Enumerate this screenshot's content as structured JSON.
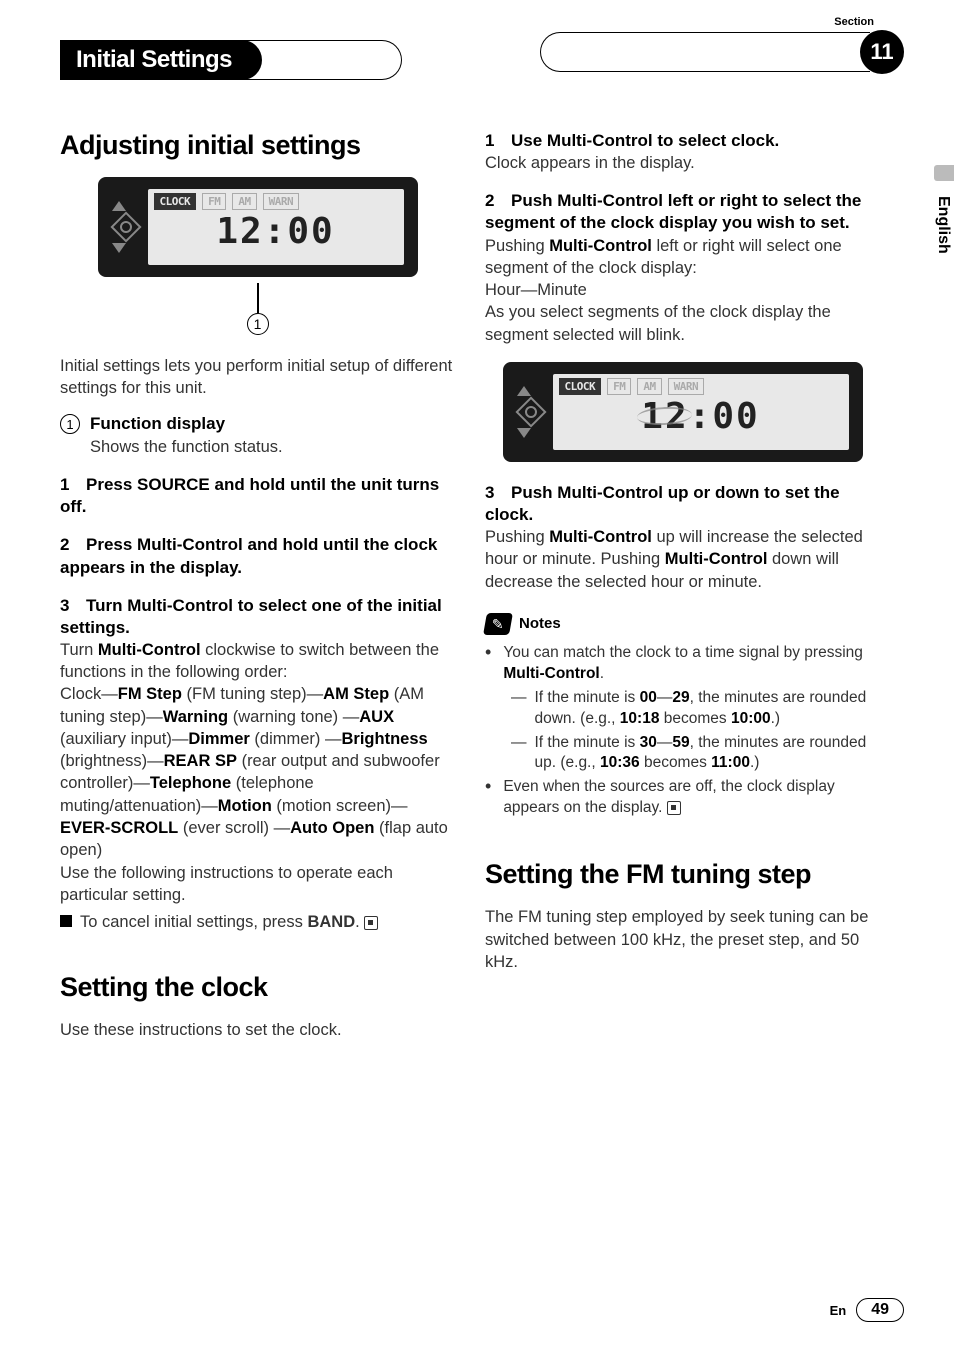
{
  "header": {
    "section_title": "Initial Settings",
    "section_label": "Section",
    "section_number": "11"
  },
  "sidebar": {
    "language": "English"
  },
  "left": {
    "h1": "Adjusting initial settings",
    "lcd": {
      "tags": [
        "CLOCK",
        "FM",
        "AM",
        "WARN"
      ],
      "time": "12:00",
      "callout": "1"
    },
    "intro": "Initial settings lets you perform initial setup of different settings for this unit.",
    "def_num": "1",
    "def_title": "Function display",
    "def_desc": "Shows the function status.",
    "step1_num": "1",
    "step1_title": "Press SOURCE and hold until the unit turns off.",
    "step2_num": "2",
    "step2_title": "Press Multi-Control and hold until the clock appears in the display.",
    "step3_num": "3",
    "step3_title": "Turn Multi-Control to select one of the initial settings.",
    "step3_body_a": "Turn ",
    "step3_body_mc": "Multi-Control",
    "step3_body_b": " clockwise to switch between the functions in the following order:",
    "step3_seq_parts": {
      "p1": "Clock—",
      "b1": "FM Step",
      "p2": " (FM tuning step)—",
      "b2": "AM Step",
      "p3": " (AM tuning step)—",
      "b3": "Warning",
      "p4": " (warning tone) —",
      "b4": "AUX",
      "p5": " (auxiliary input)—",
      "b5": "Dimmer",
      "p6": " (dimmer) —",
      "b6": "Brightness",
      "p7": " (brightness)—",
      "b7": "REAR SP",
      "p8": " (rear output and subwoofer controller)—",
      "b8": "Telephone",
      "p9": " (telephone muting/attenuation)—",
      "b9": "Motion",
      "p10": " (motion screen)—",
      "b10": "EVER-SCROLL",
      "p11": " (ever scroll) —",
      "b11": "Auto Open",
      "p12": " (flap auto open)"
    },
    "step3_tail": "Use the following instructions to operate each particular setting.",
    "tip_a": "To cancel initial settings, press ",
    "tip_b": "BAND",
    "tip_c": ".",
    "h2": "Setting the clock",
    "clock_intro": "Use these instructions to set the clock."
  },
  "right": {
    "r1_num": "1",
    "r1_title": "Use Multi-Control to select clock.",
    "r1_body": "Clock appears in the display.",
    "r2_num": "2",
    "r2_title": "Push Multi-Control left or right to select the segment of the clock display you wish to set.",
    "r2_body_a": "Pushing ",
    "r2_body_mc": "Multi-Control",
    "r2_body_b": " left or right will select one segment of the clock display:",
    "r2_body_c": "Hour—Minute",
    "r2_body_d": "As you select segments of the clock display the segment selected will blink.",
    "lcd": {
      "tags": [
        "CLOCK",
        "FM",
        "AM",
        "WARN"
      ],
      "hour": "12",
      "min": "00"
    },
    "r3_num": "3",
    "r3_title": "Push Multi-Control up or down to set the clock.",
    "r3_body_a": "Pushing ",
    "r3_body_mc1": "Multi-Control",
    "r3_body_b": " up will increase the selected hour or minute. Pushing ",
    "r3_body_mc2": "Multi-Control",
    "r3_body_c": " down will decrease the selected hour or minute.",
    "notes_title": "Notes",
    "note1_a": "You can match the clock to a time signal by pressing ",
    "note1_mc": "Multi-Control",
    "note1_b": ".",
    "note1_s1_a": "If the minute is ",
    "note1_s1_b1": "00",
    "note1_s1_dash": "—",
    "note1_s1_b2": "29",
    "note1_s1_c": ", the minutes are rounded down. (e.g., ",
    "note1_s1_b3": "10:18",
    "note1_s1_d": " becomes ",
    "note1_s1_b4": "10:00",
    "note1_s1_e": ".)",
    "note1_s2_a": "If the minute is ",
    "note1_s2_b1": "30",
    "note1_s2_dash": "—",
    "note1_s2_b2": "59",
    "note1_s2_c": ", the minutes are rounded up. (e.g., ",
    "note1_s2_b3": "10:36",
    "note1_s2_d": " becomes ",
    "note1_s2_b4": "11:00",
    "note1_s2_e": ".)",
    "note2": "Even when the sources are off, the clock display appears on the display.",
    "h3": "Setting the FM tuning step",
    "fm_intro": "The FM tuning step employed by seek tuning can be switched between 100 kHz, the preset step, and 50 kHz."
  },
  "footer": {
    "lang_code": "En",
    "page": "49"
  }
}
